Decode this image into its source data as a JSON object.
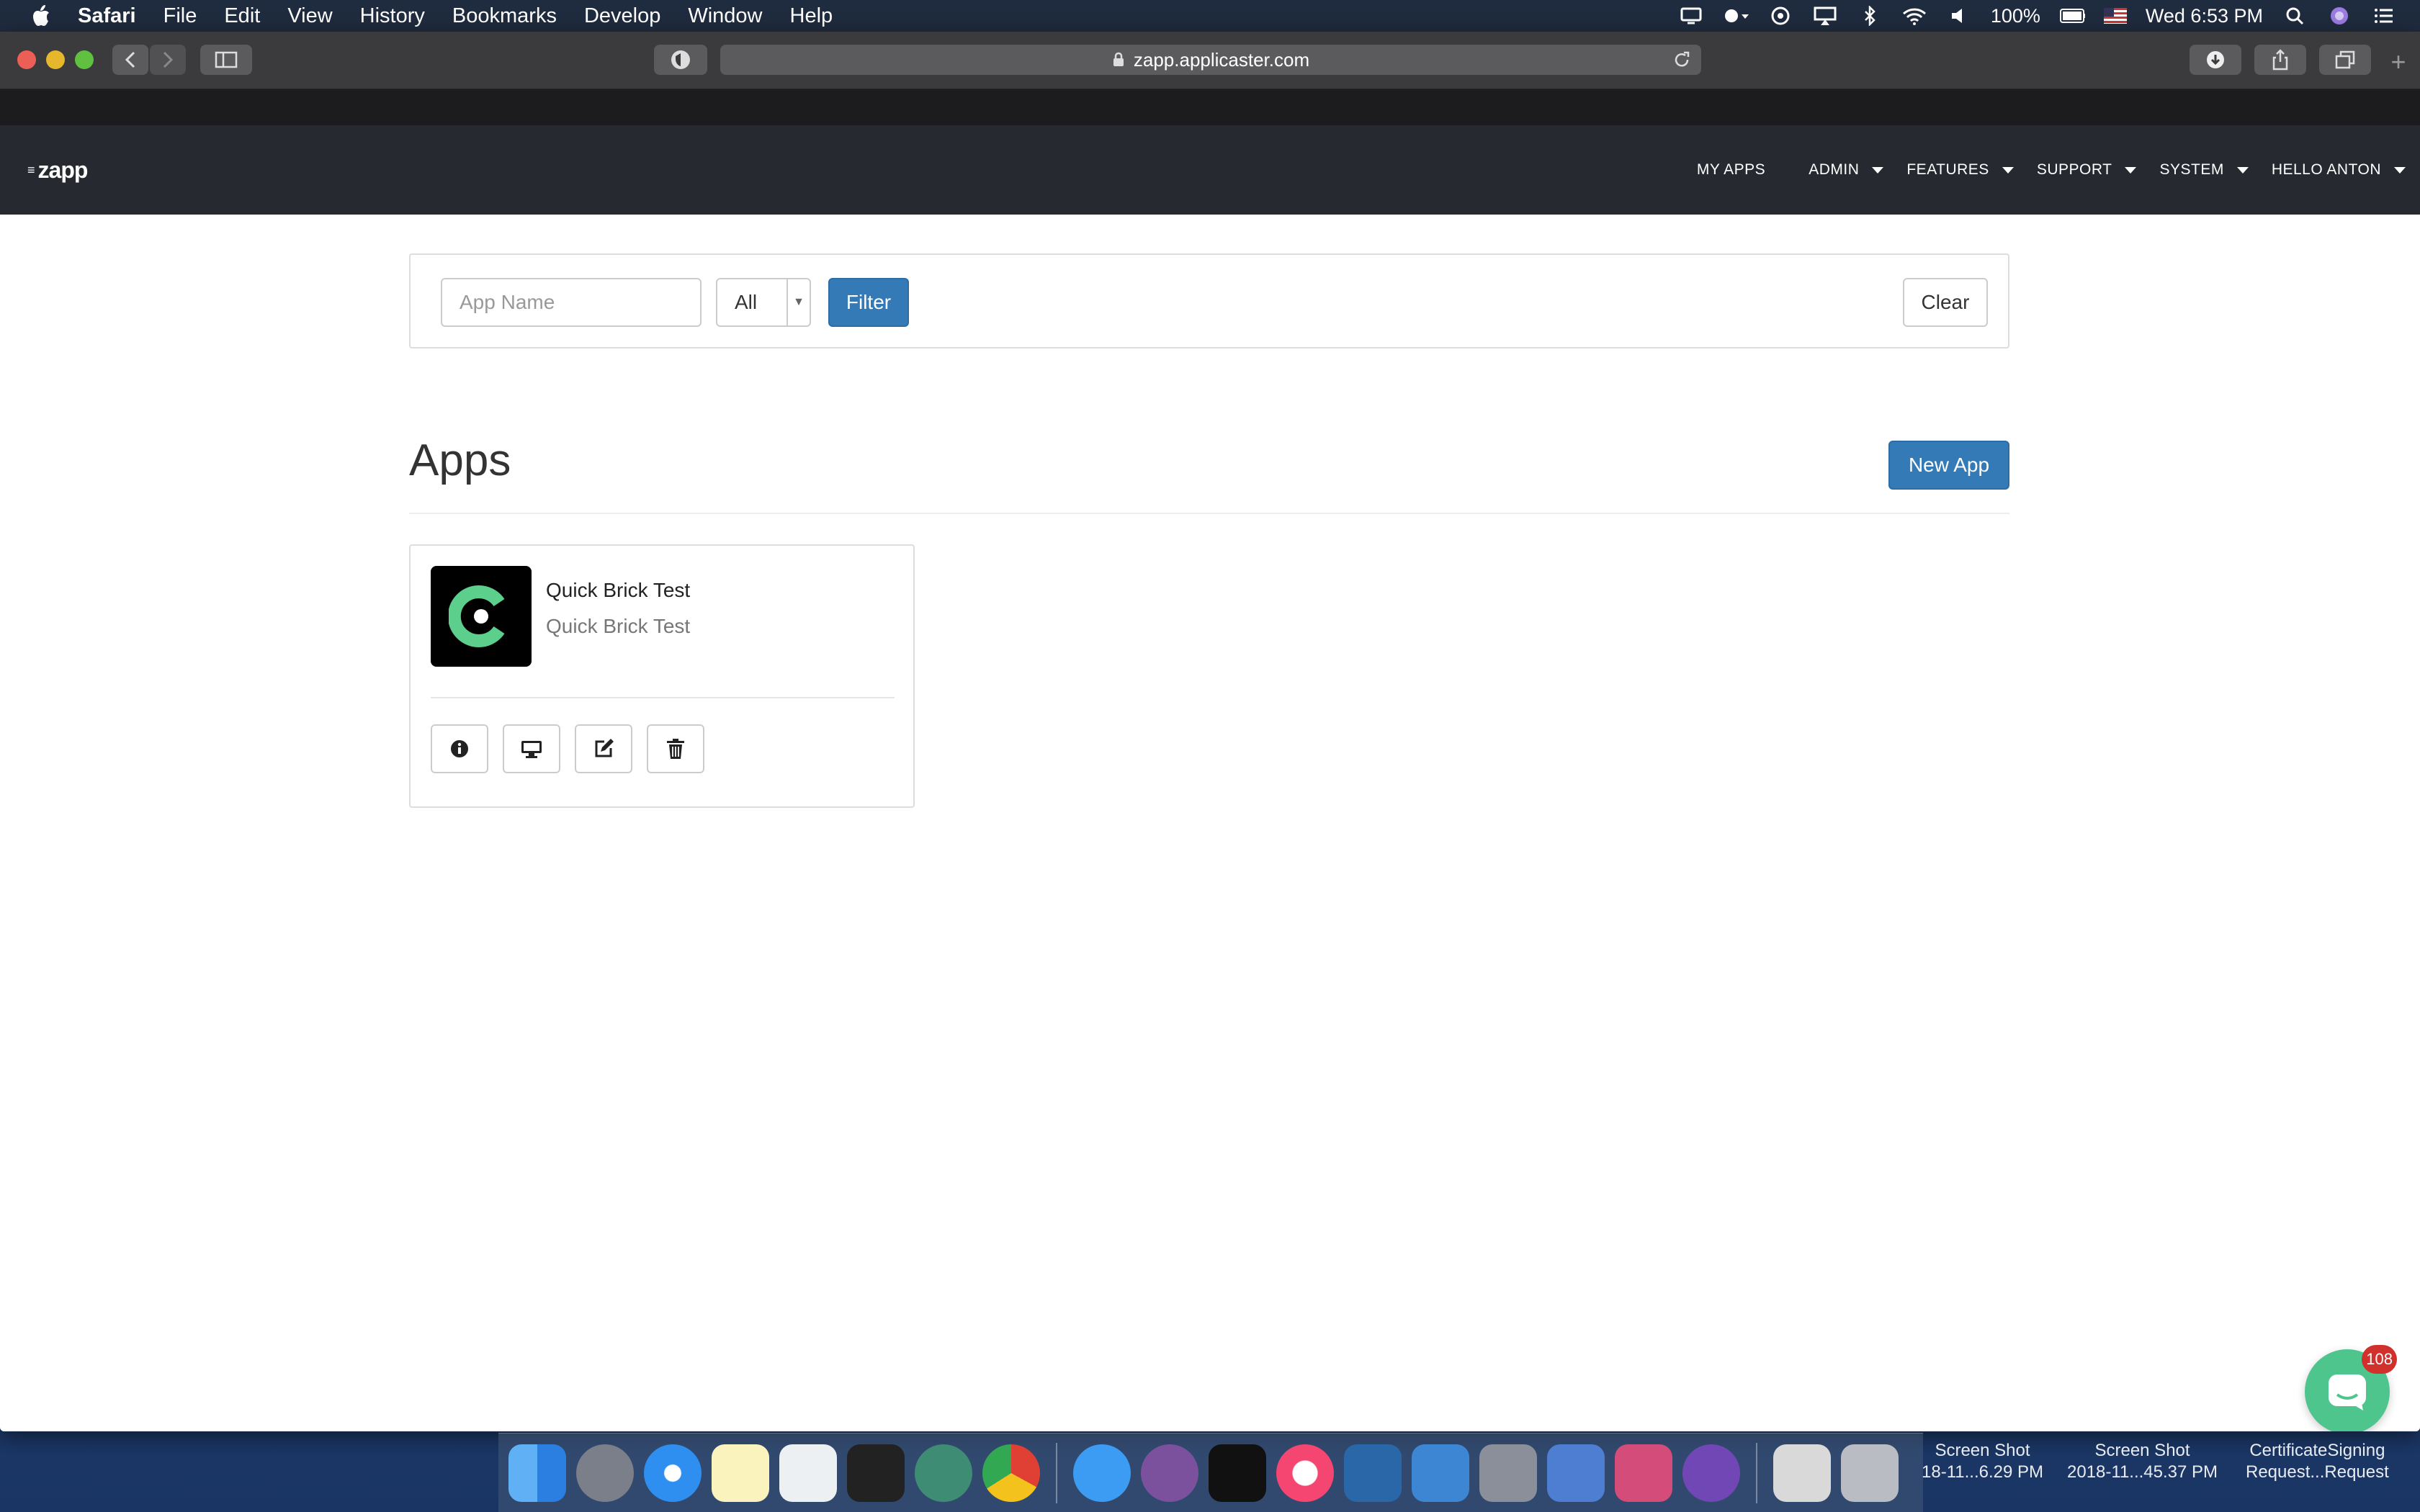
{
  "menubar": {
    "app_name": "Safari",
    "menus": [
      "File",
      "Edit",
      "View",
      "History",
      "Bookmarks",
      "Develop",
      "Window",
      "Help"
    ],
    "battery": "100%",
    "clock": "Wed 6:53 PM"
  },
  "browser": {
    "url": "zapp.applicaster.com"
  },
  "site_nav": {
    "logo": "zapp",
    "links": [
      {
        "label": "MY APPS",
        "dropdown": false
      },
      {
        "label": "ADMIN",
        "dropdown": true
      },
      {
        "label": "FEATURES",
        "dropdown": true
      },
      {
        "label": "SUPPORT",
        "dropdown": true
      },
      {
        "label": "SYSTEM",
        "dropdown": true
      },
      {
        "label": "HELLO ANTON",
        "dropdown": true
      }
    ]
  },
  "filter": {
    "app_name_placeholder": "App Name",
    "platform_selected": "All",
    "filter_label": "Filter",
    "clear_label": "Clear"
  },
  "apps_section": {
    "title": "Apps",
    "new_app_label": "New App",
    "apps": [
      {
        "name": "Quick Brick Test",
        "subtitle": "Quick Brick Test",
        "icon_color": "#5ccf8c"
      }
    ]
  },
  "chat_widget": {
    "badge_count": "108"
  },
  "desktop_files": [
    {
      "line1": "Screen Shot",
      "line2": "18-11...6.29 PM"
    },
    {
      "line1": "Screen Shot",
      "line2": "2018-11...45.37 PM"
    },
    {
      "line1": "CertificateSigning",
      "line2": "Request...Request"
    }
  ],
  "colors": {
    "primary": "#337ab7",
    "nav_bg": "#262a30",
    "chat": "#4fc58e",
    "badge": "#d0312d"
  }
}
